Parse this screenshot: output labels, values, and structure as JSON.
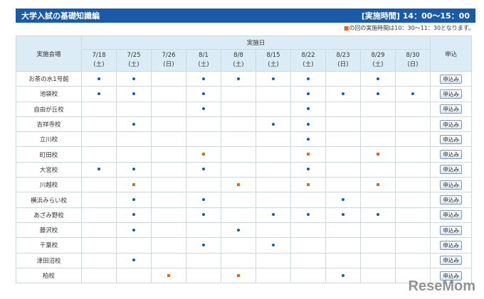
{
  "header": {
    "title": "大学入試の基礎知識編",
    "time": "[実施時間] 14：00～15：00"
  },
  "note": {
    "mark": "■",
    "text": "の回の実施時間は10：30～11：30となります。"
  },
  "table": {
    "venue_header": "実施会場",
    "dates_header": "実施日",
    "apply_header": "申込",
    "apply_label": "申込み",
    "dates": [
      {
        "date": "7/18",
        "day": "(土)"
      },
      {
        "date": "7/25",
        "day": "(土)"
      },
      {
        "date": "7/26",
        "day": "(日)"
      },
      {
        "date": "8/1",
        "day": "(土)"
      },
      {
        "date": "8/8",
        "day": "(土)"
      },
      {
        "date": "8/15",
        "day": "(土)"
      },
      {
        "date": "8/22",
        "day": "(土)"
      },
      {
        "date": "8/23",
        "day": "(日)"
      },
      {
        "date": "8/29",
        "day": "(土)"
      },
      {
        "date": "8/30",
        "day": "(日)"
      }
    ],
    "rows": [
      {
        "venue": "お茶の水1号館",
        "marks": [
          "d",
          "d",
          "",
          "d",
          "d",
          "d",
          "d",
          "",
          "d",
          ""
        ]
      },
      {
        "venue": "池袋校",
        "marks": [
          "d",
          "d",
          "",
          "d",
          "",
          "",
          "d",
          "d",
          "d",
          "d"
        ]
      },
      {
        "venue": "自由が丘校",
        "marks": [
          "",
          "",
          "",
          "d",
          "",
          "",
          "d",
          "",
          "",
          ""
        ]
      },
      {
        "venue": "吉祥寺校",
        "marks": [
          "",
          "d",
          "",
          "",
          "",
          "d",
          "d",
          "",
          "",
          ""
        ]
      },
      {
        "venue": "立川校",
        "marks": [
          "",
          "",
          "",
          "",
          "",
          "",
          "d",
          "",
          "",
          ""
        ]
      },
      {
        "venue": "町田校",
        "marks": [
          "",
          "",
          "",
          "s",
          "",
          "",
          "s",
          "",
          "s",
          ""
        ]
      },
      {
        "venue": "大宮校",
        "marks": [
          "d",
          "d",
          "",
          "d",
          "",
          "",
          "d",
          "",
          "",
          ""
        ]
      },
      {
        "venue": "川越校",
        "marks": [
          "",
          "s",
          "",
          "",
          "s",
          "",
          "s",
          "",
          "s",
          ""
        ]
      },
      {
        "venue": "横浜みらい校",
        "marks": [
          "",
          "d",
          "",
          "d",
          "",
          "",
          "",
          "d",
          "",
          ""
        ]
      },
      {
        "venue": "あざみ野校",
        "marks": [
          "",
          "d",
          "",
          "d",
          "",
          "d",
          "d",
          "d",
          "d",
          ""
        ]
      },
      {
        "venue": "藤沢校",
        "marks": [
          "",
          "d",
          "",
          "",
          "d",
          "",
          "",
          "",
          "",
          ""
        ]
      },
      {
        "venue": "千葉校",
        "marks": [
          "",
          "",
          "",
          "d",
          "",
          "d",
          "",
          "",
          "",
          ""
        ]
      },
      {
        "venue": "津田沼校",
        "marks": [
          "",
          "d",
          "",
          "",
          "",
          "",
          "",
          "",
          "",
          ""
        ]
      },
      {
        "venue": "柏校",
        "marks": [
          "",
          "",
          "s",
          "",
          "s",
          "",
          "",
          "d",
          "",
          ""
        ]
      }
    ]
  },
  "watermark": "ReseMom",
  "colors": {
    "header_bg": "#1b5aa6",
    "table_header_bg": "#dcecf6",
    "dot": "#1b5aa6",
    "square": "#e06a1e"
  }
}
